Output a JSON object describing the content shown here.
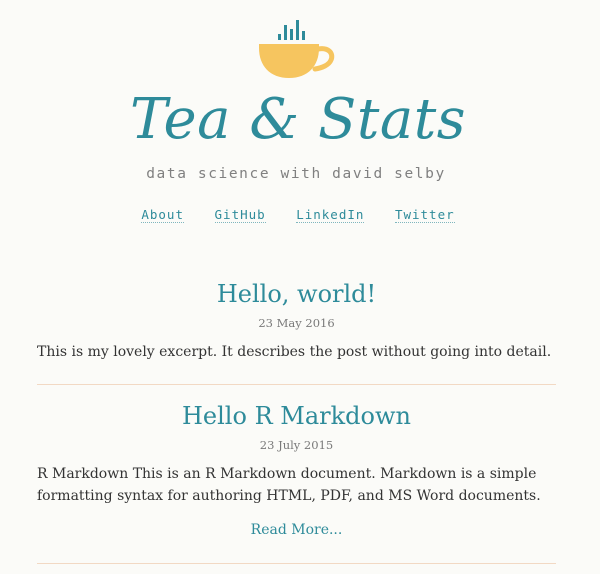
{
  "header": {
    "site_title": "Tea & Stats",
    "tagline": "data science with david selby",
    "colors": {
      "accent": "#2e8b9a",
      "cup": "#f6c55f"
    },
    "logo_icon": "teacup-bar-chart-icon"
  },
  "nav": {
    "items": [
      {
        "label": "About"
      },
      {
        "label": "GitHub"
      },
      {
        "label": "LinkedIn"
      },
      {
        "label": "Twitter"
      }
    ]
  },
  "posts": [
    {
      "title": "Hello, world!",
      "date": "23 May 2016",
      "excerpt": "This is my lovely excerpt. It describes the post without going into detail."
    },
    {
      "title": "Hello R Markdown",
      "date": "23 July 2015",
      "excerpt": "R Markdown This is an R Markdown document. Markdown is a simple formatting syntax for authoring HTML, PDF, and MS Word documents.",
      "read_more": "Read More..."
    }
  ]
}
